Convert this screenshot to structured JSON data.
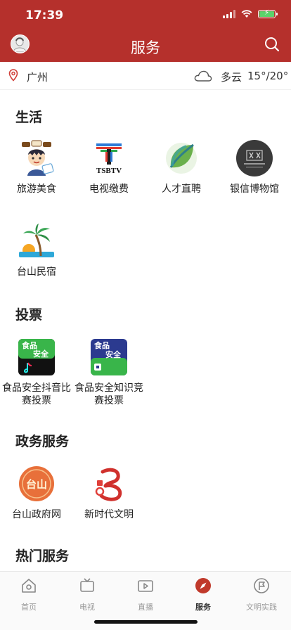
{
  "status": {
    "time": "17:39"
  },
  "header": {
    "title": "服务"
  },
  "location": {
    "city": "广州",
    "weather": "多云",
    "temperature": "15°/20°"
  },
  "sections": {
    "life": {
      "title": "生活",
      "items": [
        "旅游美食",
        "电视缴费",
        "人才直聘",
        "银信博物馆",
        "台山民宿"
      ]
    },
    "vote": {
      "title": "投票",
      "items": [
        "食品安全抖音比赛投票",
        "食品安全知识竞赛投票"
      ]
    },
    "gov": {
      "title": "政务服务",
      "items": [
        "台山政府网",
        "新时代文明"
      ]
    },
    "hot": {
      "title": "热门服务"
    }
  },
  "icon_text": {
    "tv_logo": "TSBTV",
    "food_safety": "食品\n安全",
    "taishan": "台山"
  },
  "tabs": [
    "首页",
    "电视",
    "直播",
    "服务",
    "文明实践"
  ],
  "colors": {
    "brand": "#b5302c",
    "tab_active": "#c0392b",
    "tab_inactive": "#999999"
  }
}
